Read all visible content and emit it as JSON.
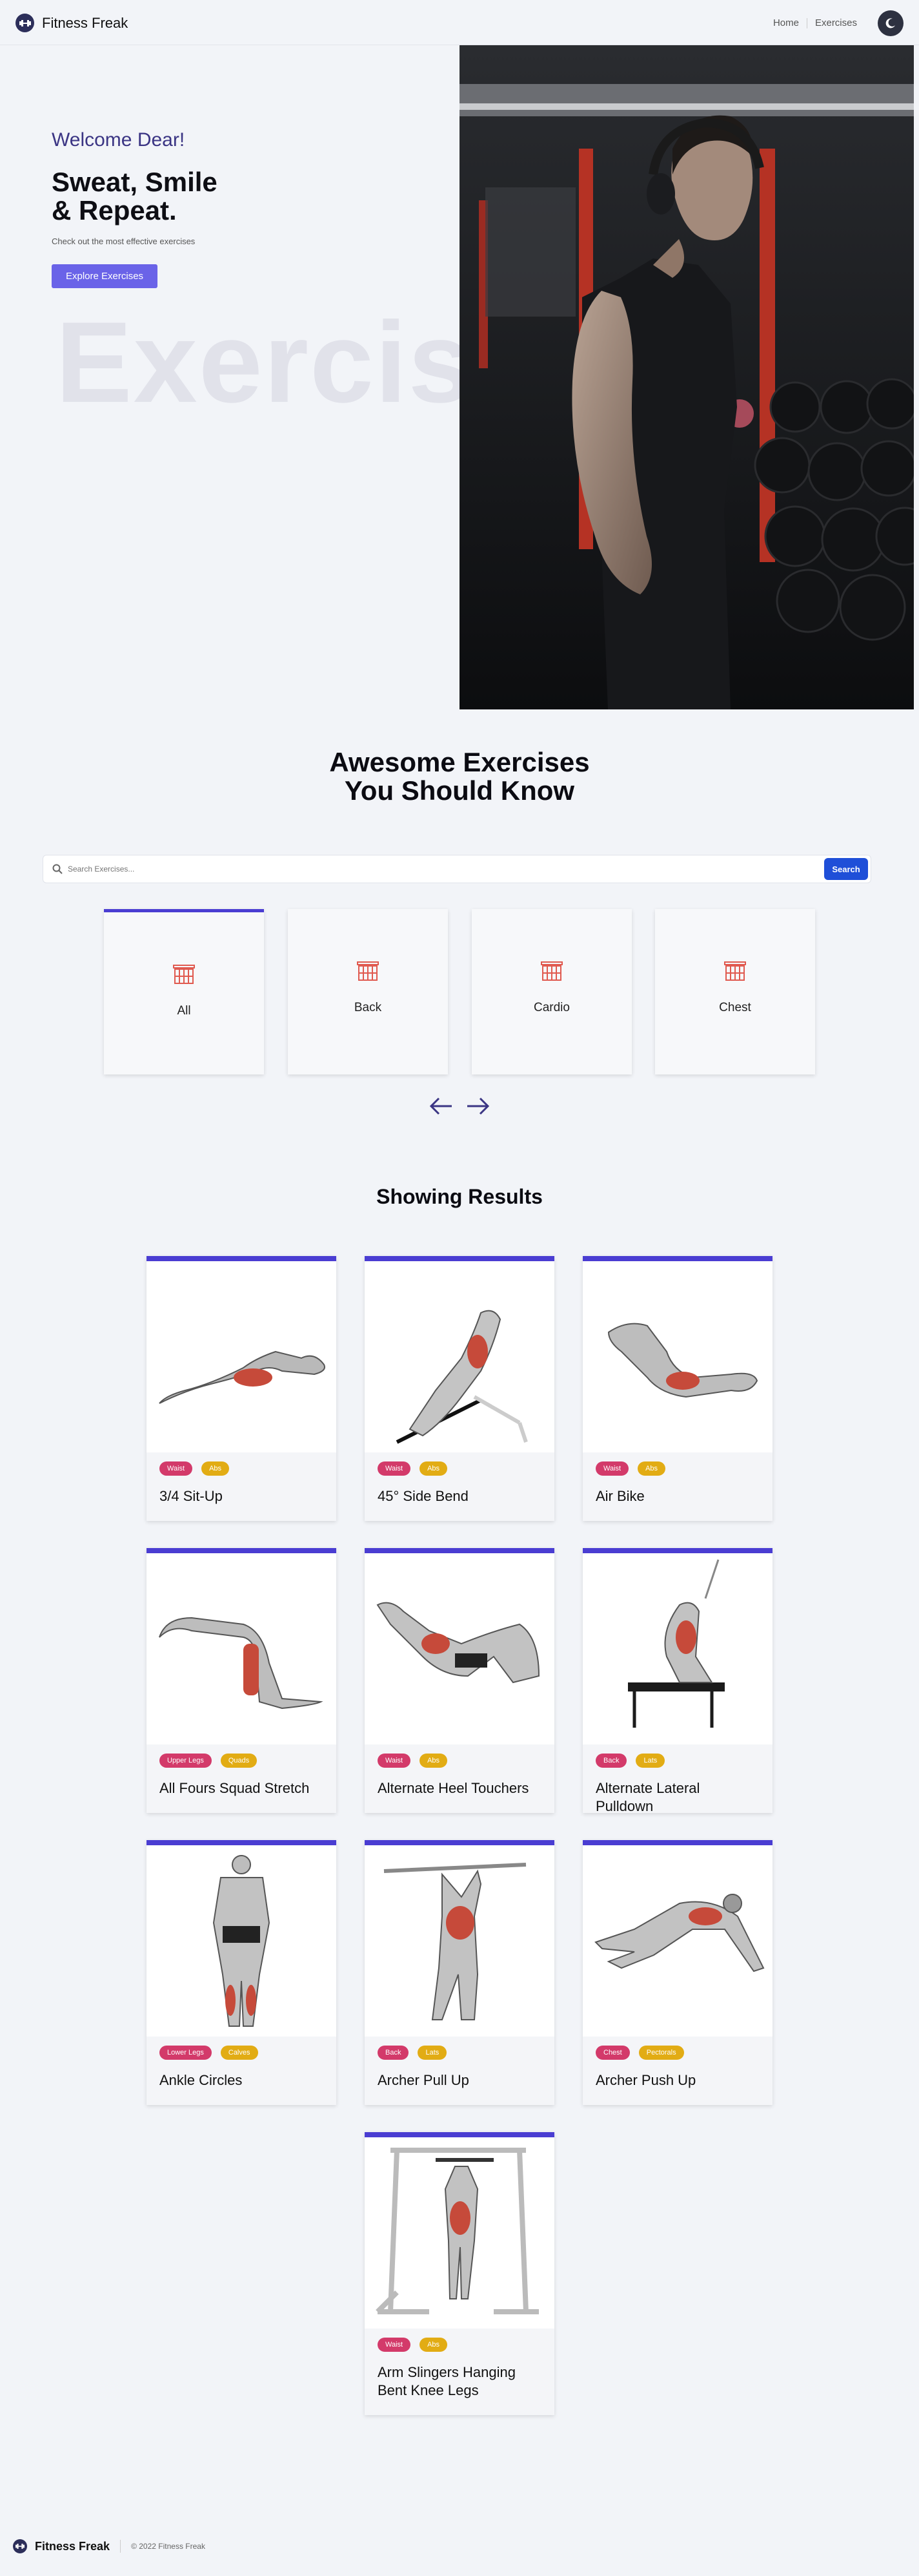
{
  "nav": {
    "brand": "Fitness Freak",
    "links": [
      "Home",
      "Exercises"
    ]
  },
  "hero": {
    "welcome": "Welcome Dear!",
    "title_line1": "Sweat, Smile",
    "title_line2": "& Repeat.",
    "subtitle": "Check out the most effective exercises",
    "cta": "Explore Exercises",
    "watermark": "Exercise"
  },
  "exercises_section": {
    "title_line1": "Awesome Exercises",
    "title_line2": "You Should Know"
  },
  "search": {
    "placeholder": "Search Exercises...",
    "button": "Search"
  },
  "categories": [
    {
      "label": "All",
      "active": true
    },
    {
      "label": "Back",
      "active": false
    },
    {
      "label": "Cardio",
      "active": false
    },
    {
      "label": "Chest",
      "active": false
    }
  ],
  "results": {
    "title": "Showing Results",
    "items": [
      {
        "name": "3/4 Sit-Up",
        "tags": [
          "Waist",
          "Abs"
        ]
      },
      {
        "name": "45° Side Bend",
        "tags": [
          "Waist",
          "Abs"
        ]
      },
      {
        "name": "Air Bike",
        "tags": [
          "Waist",
          "Abs"
        ]
      },
      {
        "name": "All Fours Squad Stretch",
        "tags": [
          "Upper Legs",
          "Quads"
        ]
      },
      {
        "name": "Alternate Heel Touchers",
        "tags": [
          "Waist",
          "Abs"
        ]
      },
      {
        "name": "Alternate Lateral Pulldown",
        "tags": [
          "Back",
          "Lats"
        ]
      },
      {
        "name": "Ankle Circles",
        "tags": [
          "Lower Legs",
          "Calves"
        ]
      },
      {
        "name": "Archer Pull Up",
        "tags": [
          "Back",
          "Lats"
        ]
      },
      {
        "name": "Archer Push Up",
        "tags": [
          "Chest",
          "Pectorals"
        ]
      },
      {
        "name": "Arm Slingers Hanging Bent Knee Legs",
        "tags": [
          "Waist",
          "Abs"
        ]
      }
    ]
  },
  "footer": {
    "brand": "Fitness Freak",
    "copyright": "© 2022 Fitness Freak"
  },
  "colors": {
    "accent": "#4a3dd2",
    "button": "#6a63e8",
    "search_button": "#1f4fd8",
    "tag_part": "#d33a6a",
    "tag_target": "#e2ac14"
  }
}
